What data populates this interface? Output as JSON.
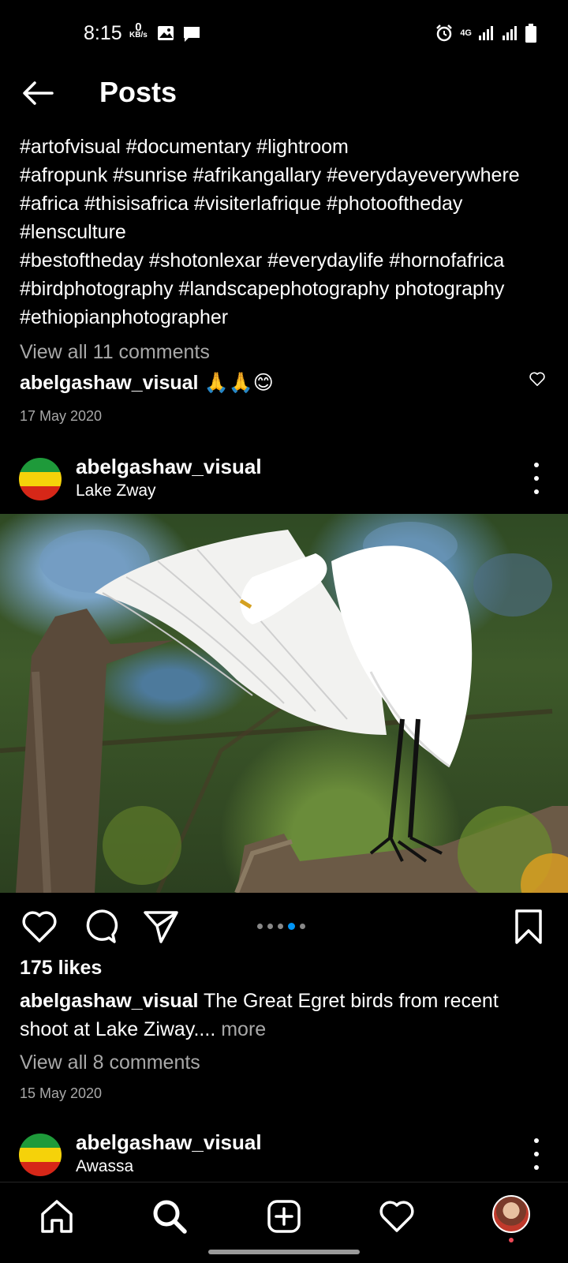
{
  "status": {
    "time": "8:15",
    "kb_value": "0",
    "kb_unit": "KB/s",
    "network": "4G"
  },
  "header": {
    "title": "Posts"
  },
  "prev_post": {
    "caption_lines": [
      "#artofvisual #documentary  #lightroom",
      "#afropunk  #sunrise  #afrikangallary #everydayeverywhere",
      "#africa  #thisisafrica #visiterlafrique #photooftheday",
      "#lensculture",
      "#bestoftheday #shotonlexar #everydaylife #hornofafrica",
      "#birdphotography #landscapephotography photography",
      "#ethiopianphotographer"
    ],
    "view_comments": "View all 11 comments",
    "comment_user": "abelgashaw_visual",
    "comment_text": "🙏🙏😊",
    "date": "17 May 2020"
  },
  "post": {
    "username": "abelgashaw_visual",
    "location": "Lake Zway",
    "likes": "175 likes",
    "caption_user": "abelgashaw_visual",
    "caption_text": "The Great Egret birds from recent shoot at Lake Ziway....",
    "more_label": "more",
    "view_comments": "View all 8 comments",
    "date": "15 May 2020",
    "carousel_active_index": 3,
    "carousel_count": 5
  },
  "next_post": {
    "username": "abelgashaw_visual",
    "location": "Awassa"
  },
  "colors": {
    "background": "#000000",
    "secondary_text": "#a8a8a8",
    "carousel_active": "#0095f6",
    "notification_dot": "#ed4956",
    "flag_green": "#1e9a3a",
    "flag_yellow": "#f5d20a",
    "flag_red": "#d62718"
  },
  "icons": [
    "back-arrow-icon",
    "heart-icon",
    "comment-icon",
    "share-icon",
    "bookmark-icon",
    "home-icon",
    "search-icon",
    "add-icon",
    "activity-heart-icon",
    "profile-avatar"
  ]
}
